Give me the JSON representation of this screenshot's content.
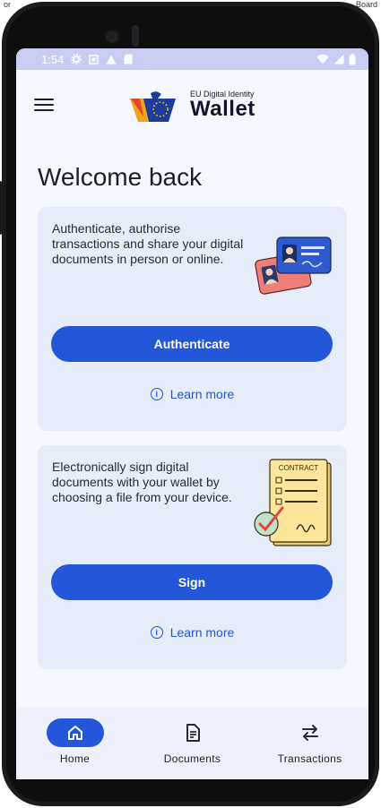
{
  "background": {
    "left_text": "or",
    "right_text": "Board"
  },
  "status_bar": {
    "time": "1:54",
    "icons_left": [
      "gear-icon",
      "square-icon",
      "warning-icon",
      "sd-card-icon"
    ],
    "icons_right": [
      "wifi-icon",
      "signal-icon",
      "battery-icon"
    ]
  },
  "app_bar": {
    "logo_subtitle": "EU Digital Identity",
    "logo_title": "Wallet"
  },
  "page": {
    "title": "Welcome back"
  },
  "cards": [
    {
      "text": "Authenticate, authorise transactions and share your digital documents in person or online.",
      "button_label": "Authenticate",
      "learn_more": "Learn more",
      "illustration": "id-cards-illustration"
    },
    {
      "text": "Electronically sign digital documents with your wallet by choosing a file from your device.",
      "button_label": "Sign",
      "learn_more": "Learn more",
      "illustration": "contract-illustration",
      "illustration_text": "CONTRACT"
    }
  ],
  "bottom_nav": [
    {
      "label": "Home",
      "icon": "home-icon",
      "active": true
    },
    {
      "label": "Documents",
      "icon": "document-icon",
      "active": false
    },
    {
      "label": "Transactions",
      "icon": "transfer-icon",
      "active": false
    }
  ],
  "colors": {
    "primary": "#2356d8",
    "card_bg": "#e7ecf9",
    "screen_bg": "#f5f8fe",
    "status_bar": "#c9cdf3"
  }
}
